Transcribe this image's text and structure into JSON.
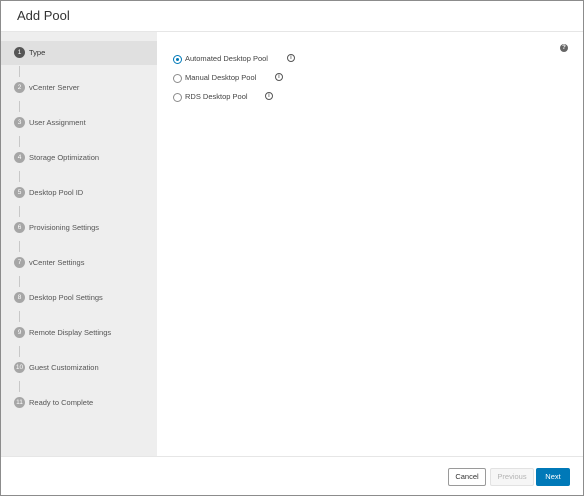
{
  "dialog": {
    "title": "Add Pool"
  },
  "steps": [
    {
      "number": "1",
      "label": "Type"
    },
    {
      "number": "2",
      "label": "vCenter Server"
    },
    {
      "number": "3",
      "label": "User Assignment"
    },
    {
      "number": "4",
      "label": "Storage Optimization"
    },
    {
      "number": "5",
      "label": "Desktop Pool ID"
    },
    {
      "number": "6",
      "label": "Provisioning Settings"
    },
    {
      "number": "7",
      "label": "vCenter Settings"
    },
    {
      "number": "8",
      "label": "Desktop Pool Settings"
    },
    {
      "number": "9",
      "label": "Remote Display Settings"
    },
    {
      "number": "10",
      "label": "Guest Customization"
    },
    {
      "number": "11",
      "label": "Ready to Complete"
    }
  ],
  "content": {
    "help_glyph": "?",
    "info_glyph": "i",
    "options": [
      {
        "label": "Automated Desktop Pool",
        "selected": true
      },
      {
        "label": "Manual Desktop Pool",
        "selected": false
      },
      {
        "label": "RDS Desktop Pool",
        "selected": false
      }
    ]
  },
  "footer": {
    "cancel_label": "Cancel",
    "previous_label": "Previous",
    "next_label": "Next"
  },
  "colors": {
    "accent": "#0079b8",
    "sidebar_bg": "#eeeeee",
    "active_step_bg": "#e0e0e0"
  }
}
